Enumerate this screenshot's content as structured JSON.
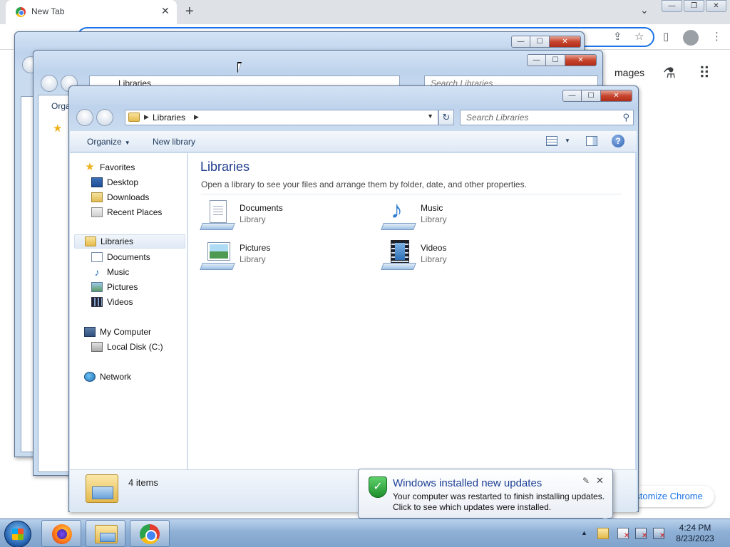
{
  "chrome": {
    "tab_title": "New Tab",
    "tab_close": "✕",
    "new_tab": "+",
    "tab_search": "⌄",
    "win_min": "—",
    "win_restore": "❐",
    "win_close": "✕",
    "share_icon": "⇪",
    "star_icon": "☆",
    "sidepanel_icon": "▯",
    "menu_icon": "⋮",
    "images_link": "mages",
    "labs_icon": "⚗",
    "apps_icon": "⠿",
    "customize_label": "ustomize Chrome"
  },
  "bg_window_2": {
    "address": "Libraries",
    "search_placeholder": "Search Libraries",
    "organize_partial": "Orga"
  },
  "explorer": {
    "address_crumb": "Libraries",
    "refresh_icon": "↻",
    "search_placeholder": "Search Libraries",
    "search_icon": "⚲",
    "toolbar": {
      "organize": "Organize",
      "organize_arrow": "▼",
      "new_library": "New library",
      "views_arrow": "▼",
      "help": "?"
    },
    "nav": {
      "favorites": "Favorites",
      "desktop": "Desktop",
      "downloads": "Downloads",
      "recent_places": "Recent Places",
      "libraries": "Libraries",
      "documents": "Documents",
      "music": "Music",
      "pictures": "Pictures",
      "videos": "Videos",
      "my_computer": "My Computer",
      "local_disk": "Local Disk (C:)",
      "network": "Network"
    },
    "content": {
      "title": "Libraries",
      "subtitle": "Open a library to see your files and arrange them by folder, date, and other properties.",
      "items": [
        {
          "name": "Documents",
          "type": "Library"
        },
        {
          "name": "Music",
          "type": "Library"
        },
        {
          "name": "Pictures",
          "type": "Library"
        },
        {
          "name": "Videos",
          "type": "Library"
        }
      ]
    },
    "status": {
      "count": "4 items"
    }
  },
  "notification": {
    "title": "Windows installed new updates",
    "line1": "Your computer was restarted to finish installing updates.",
    "line2": "Click to see which updates were installed.",
    "check": "✓",
    "pin": "✎",
    "close": "✕"
  },
  "taskbar": {
    "tray_arrow": "▲",
    "tray_x": "✕",
    "time": "4:24 PM",
    "date": "8/23/2023"
  },
  "window_buttons": {
    "min": "—",
    "max": "☐",
    "close": "✕"
  }
}
